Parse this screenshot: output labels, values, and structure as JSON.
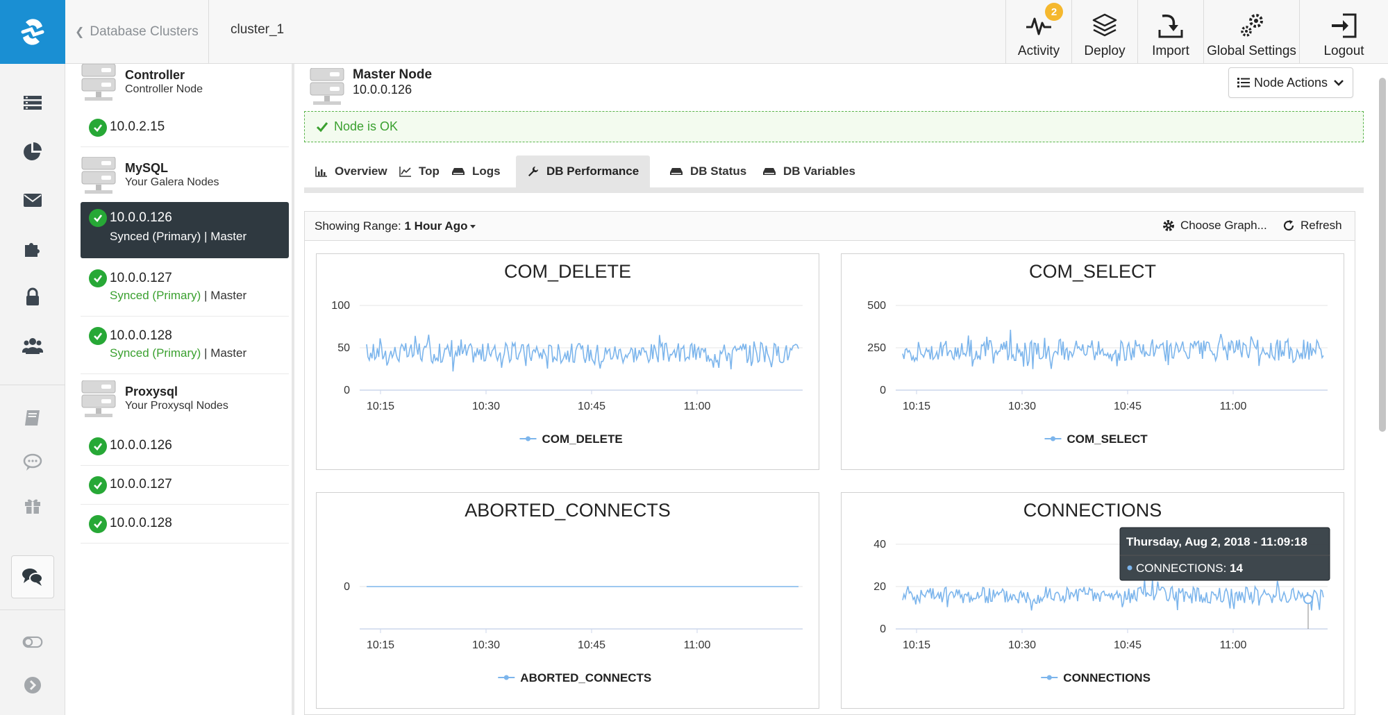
{
  "topbar": {
    "back_label": "Database Clusters",
    "cluster": "cluster_1",
    "buttons": [
      {
        "label": "Activity",
        "icon": "pulse-icon",
        "badge": "2"
      },
      {
        "label": "Deploy",
        "icon": "layers-icon"
      },
      {
        "label": "Import",
        "icon": "import-icon"
      },
      {
        "label": "Global Settings",
        "icon": "gears-icon"
      },
      {
        "label": "Logout",
        "icon": "logout-icon"
      }
    ]
  },
  "rail": {
    "icons": [
      "clusters-icon",
      "pie-chart-icon",
      "envelope-icon",
      "puzzle-icon",
      "lock-icon",
      "users-icon",
      "book-icon",
      "comment-icon",
      "gift-icon",
      "chat-icon",
      "toggle-icon",
      "chevron-right-icon"
    ]
  },
  "nodes": {
    "groups": [
      {
        "title": "Controller",
        "subtitle": "Controller Node"
      },
      {
        "title": "MySQL",
        "subtitle": "Your Galera Nodes"
      },
      {
        "title": "Proxysql",
        "subtitle": "Your Proxysql Nodes"
      }
    ],
    "controller": [
      {
        "ip": "10.0.2.15"
      }
    ],
    "mysql": [
      {
        "ip": "10.0.0.126",
        "sync": "Synced (Primary)",
        "sep": " | ",
        "role": "Master",
        "active": true
      },
      {
        "ip": "10.0.0.127",
        "sync": "Synced (Primary)",
        "sep": " | ",
        "role": "Master"
      },
      {
        "ip": "10.0.0.128",
        "sync": "Synced (Primary)",
        "sep": " | ",
        "role": "Master"
      }
    ],
    "proxysql": [
      {
        "ip": "10.0.0.126"
      },
      {
        "ip": "10.0.0.127"
      },
      {
        "ip": "10.0.0.128"
      }
    ]
  },
  "main": {
    "node_title": "Master Node",
    "node_ip": "10.0.0.126",
    "node_actions": "Node Actions",
    "status": "Node is OK",
    "tabs": [
      {
        "label": "Overview",
        "icon": "bar-chart-icon"
      },
      {
        "label": "Top",
        "icon": "line-chart-icon"
      },
      {
        "label": "Logs",
        "icon": "hdd-icon"
      },
      {
        "label": "DB Performance",
        "icon": "wrench-icon",
        "active": true
      },
      {
        "label": "DB Status",
        "icon": "hdd-icon"
      },
      {
        "label": "DB Variables",
        "icon": "hdd-icon"
      }
    ],
    "range_prefix": "Showing Range:",
    "range_value": "1 Hour Ago",
    "choose_graph": "Choose Graph...",
    "refresh": "Refresh"
  },
  "chart_data": [
    {
      "type": "line",
      "title": "COM_DELETE",
      "series": [
        {
          "name": "COM_DELETE",
          "mean": 44,
          "spread": 12
        }
      ],
      "x_ticks": [
        "10:15",
        "10:30",
        "10:45",
        "11:00"
      ],
      "y_ticks": [
        0,
        50,
        100
      ],
      "ylim": [
        0,
        100
      ],
      "color": "#7cb5ec"
    },
    {
      "type": "line",
      "title": "COM_SELECT",
      "series": [
        {
          "name": "COM_SELECT",
          "mean": 235,
          "spread": 65
        }
      ],
      "x_ticks": [
        "10:15",
        "10:30",
        "10:45",
        "11:00"
      ],
      "y_ticks": [
        0,
        250,
        500
      ],
      "ylim": [
        0,
        500
      ],
      "color": "#7cb5ec"
    },
    {
      "type": "line",
      "title": "ABORTED_CONNECTS",
      "series": [
        {
          "name": "ABORTED_CONNECTS",
          "mean": 0,
          "spread": 0
        }
      ],
      "x_ticks": [
        "10:15",
        "10:30",
        "10:45",
        "11:00"
      ],
      "y_ticks": [
        0
      ],
      "ylim": [
        -1,
        1
      ],
      "color": "#7cb5ec"
    },
    {
      "type": "line",
      "title": "CONNECTIONS",
      "series": [
        {
          "name": "CONNECTIONS",
          "mean": 16,
          "spread": 4
        }
      ],
      "x_ticks": [
        "10:15",
        "10:30",
        "10:45",
        "11:00"
      ],
      "y_ticks": [
        0,
        20,
        40
      ],
      "ylim": [
        0,
        40
      ],
      "color": "#7cb5ec",
      "tooltip": {
        "date": "Thursday, Aug 2, 2018 - 11:09:18",
        "series": "CONNECTIONS",
        "value": "14"
      }
    }
  ]
}
